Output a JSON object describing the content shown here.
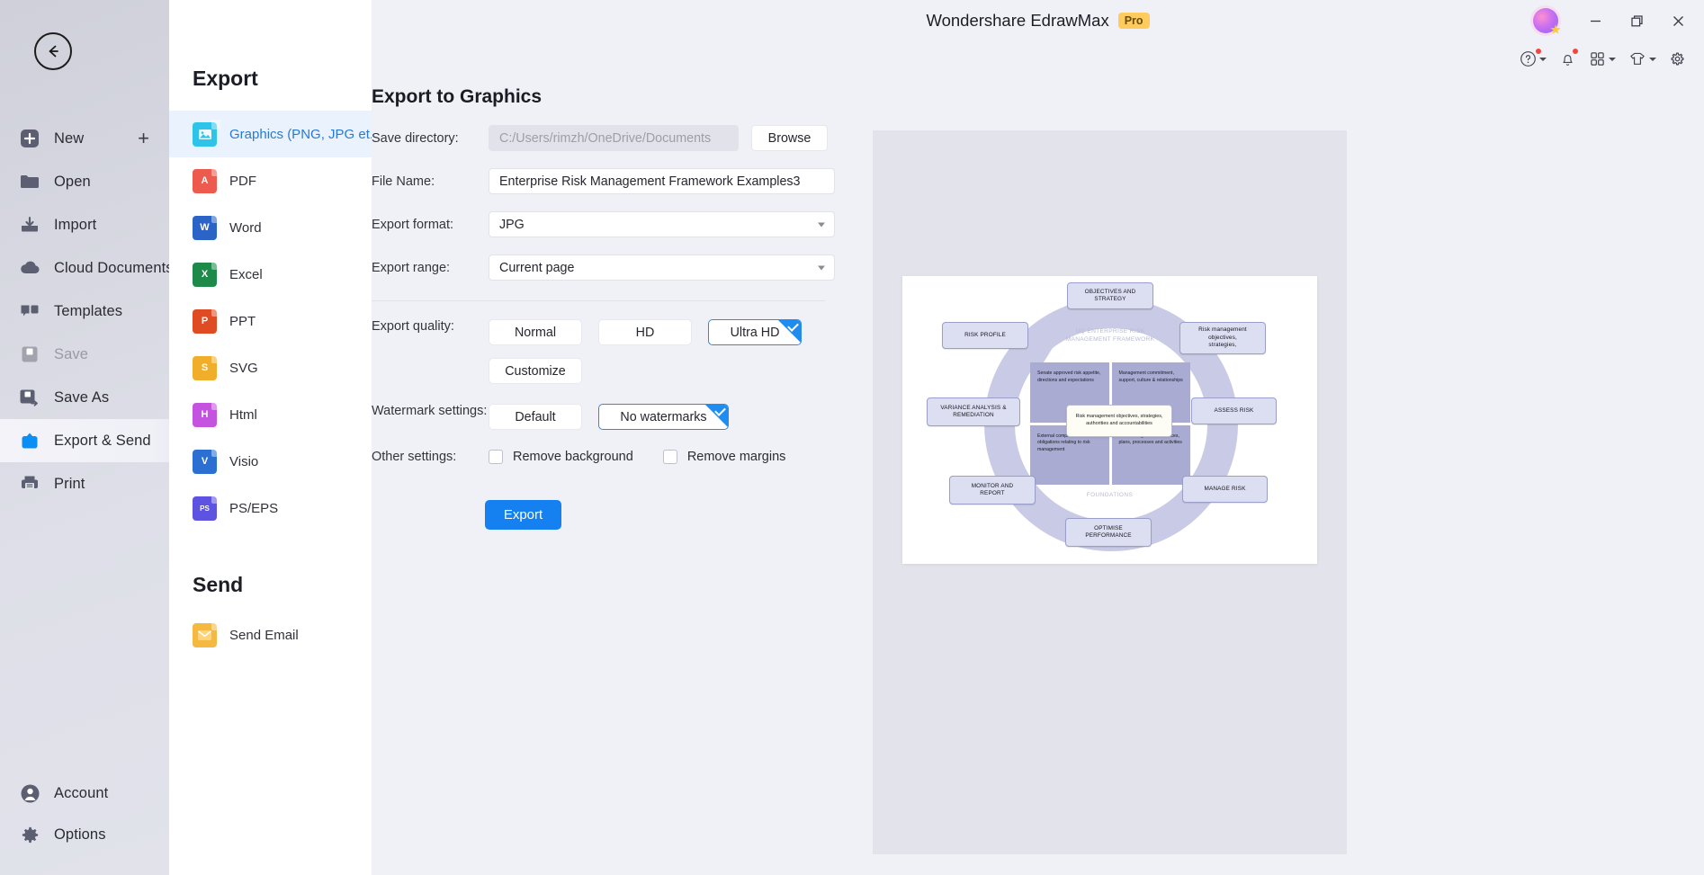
{
  "window": {
    "app_title": "Wondershare EdrawMax",
    "pro_badge": "Pro",
    "minimize": "minimize-icon",
    "restore": "restore-icon",
    "close": "close-icon"
  },
  "toolbar": {
    "help": "help-icon",
    "notifications": "bell-icon",
    "apps": "grid-apps-icon",
    "theme": "shirt-theme-icon",
    "settings": "gear-icon"
  },
  "rail": {
    "back": "back-arrow-icon",
    "items": [
      {
        "label": "New",
        "icon": "new-plus-icon",
        "state": "normal",
        "trailing": "+"
      },
      {
        "label": "Open",
        "icon": "folder-icon",
        "state": "normal"
      },
      {
        "label": "Import",
        "icon": "import-icon",
        "state": "normal"
      },
      {
        "label": "Cloud Documents",
        "icon": "cloud-icon",
        "state": "normal"
      },
      {
        "label": "Templates",
        "icon": "templates-icon",
        "state": "normal"
      },
      {
        "label": "Save",
        "icon": "save-icon",
        "state": "disabled"
      },
      {
        "label": "Save As",
        "icon": "save-as-icon",
        "state": "normal"
      },
      {
        "label": "Export & Send",
        "icon": "export-send-icon",
        "state": "active"
      },
      {
        "label": "Print",
        "icon": "printer-icon",
        "state": "normal"
      }
    ],
    "bottom_items": [
      {
        "label": "Account",
        "icon": "account-icon"
      },
      {
        "label": "Options",
        "icon": "options-gear-icon"
      }
    ]
  },
  "export_panel": {
    "title": "Export",
    "formats": [
      {
        "label": "Graphics (PNG, JPG et...",
        "icon": "image-file-icon",
        "color": "#2ec3e8",
        "glyph": "",
        "selected": true
      },
      {
        "label": "PDF",
        "icon": "pdf-file-icon",
        "color": "#ec5b4e",
        "glyph": "A",
        "selected": false
      },
      {
        "label": "Word",
        "icon": "word-file-icon",
        "color": "#2b63c6",
        "glyph": "W",
        "selected": false
      },
      {
        "label": "Excel",
        "icon": "excel-file-icon",
        "color": "#1d8a49",
        "glyph": "X",
        "selected": false
      },
      {
        "label": "PPT",
        "icon": "ppt-file-icon",
        "color": "#df4b22",
        "glyph": "P",
        "selected": false
      },
      {
        "label": "SVG",
        "icon": "svg-file-icon",
        "color": "#f0ae2a",
        "glyph": "S",
        "selected": false
      },
      {
        "label": "Html",
        "icon": "html-file-icon",
        "color": "#c453e0",
        "glyph": "H",
        "selected": false
      },
      {
        "label": "Visio",
        "icon": "visio-file-icon",
        "color": "#2a6fd1",
        "glyph": "V",
        "selected": false
      },
      {
        "label": "PS/EPS",
        "icon": "ps-eps-file-icon",
        "color": "#5d53e0",
        "glyph": "PS",
        "selected": false
      }
    ],
    "send_title": "Send",
    "send_items": [
      {
        "label": "Send Email",
        "icon": "mail-icon",
        "color": "#f5b942",
        "glyph": ""
      }
    ]
  },
  "form": {
    "heading": "Export to Graphics",
    "save_directory_label": "Save directory:",
    "save_directory_value": "C:/Users/rimzh/OneDrive/Documents",
    "browse_label": "Browse",
    "file_name_label": "File Name:",
    "file_name_value": "Enterprise Risk Management Framework Examples3",
    "export_format_label": "Export format:",
    "export_format_value": "JPG",
    "export_range_label": "Export range:",
    "export_range_value": "Current page",
    "export_quality_label": "Export quality:",
    "quality_options": [
      {
        "label": "Normal",
        "selected": false
      },
      {
        "label": "HD",
        "selected": false
      },
      {
        "label": "Ultra HD",
        "selected": true
      }
    ],
    "customize_label": "Customize",
    "watermark_label": "Watermark settings:",
    "watermark_options": [
      {
        "label": "Default",
        "selected": false
      },
      {
        "label": "No watermarks",
        "selected": true
      }
    ],
    "other_settings_label": "Other settings:",
    "checkboxes": [
      {
        "label": "Remove background",
        "checked": false
      },
      {
        "label": "Remove margins",
        "checked": false
      }
    ],
    "export_button": "Export",
    "accent_color": "#1580f0"
  },
  "preview": {
    "diagram": {
      "center_title": "UQ ENTERPRISE RISK\nMANAGEMENT FRAMEWORK",
      "foundations_label": "FOUNDATIONS",
      "cycle_nodes": [
        "OBJECTIVES AND\nSTRATEGY",
        "Risk management\nobjectives,\nstrategies,",
        "ASSESS RISK",
        "MANAGE RISK",
        "OPTIMISE\nPERFORMANCE",
        "MONITOR AND\nREPORT",
        "VARIANCE ANALYSIS &\nREMEDIATION",
        "RISK PROFILE"
      ],
      "quadrants": [
        "Senate approved risk appetite, directions and expectations",
        "Management commitment, support, culture & relationships",
        "External compliance obligations relating to risk management",
        "Risk management resources, plans, processes and activities"
      ],
      "center_box": "Risk management objectives, strategies, authorities and accountabilities"
    }
  }
}
